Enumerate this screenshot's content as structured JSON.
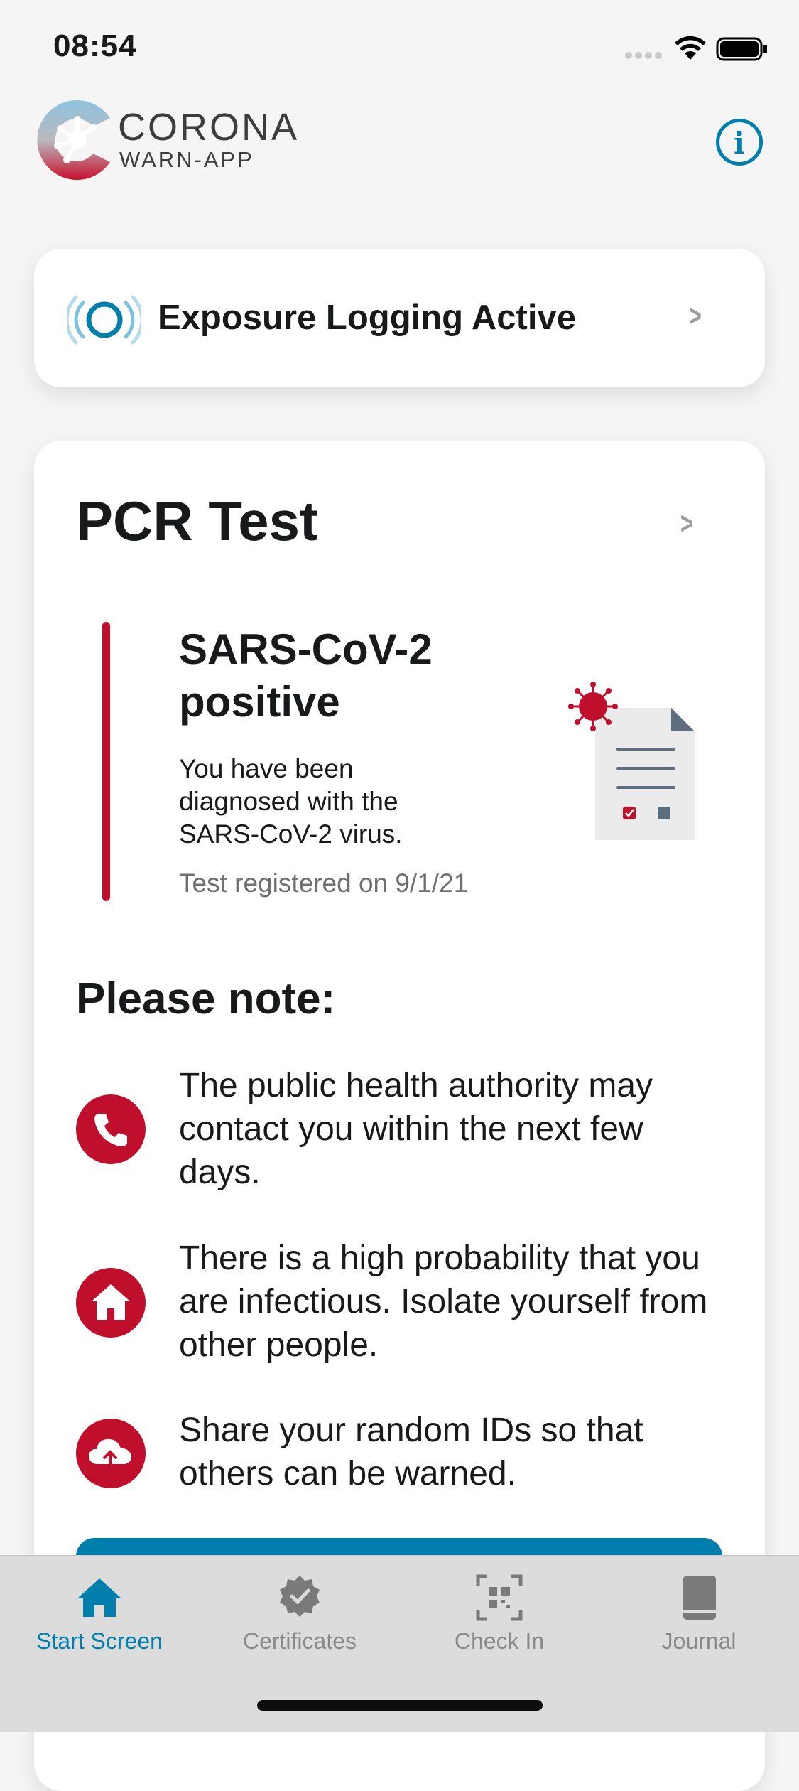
{
  "status_bar": {
    "time": "08:54"
  },
  "header": {
    "logo_title": "CORONA",
    "logo_subtitle": "WARN-APP",
    "info_glyph": "i"
  },
  "exposure_card": {
    "label": "Exposure Logging Active",
    "icon": "exposure-logging-icon"
  },
  "test_card": {
    "title": "PCR Test",
    "result_title": "SARS-CoV-2 positive",
    "result_description": "You have been diagnosed with the SARS-CoV-2 virus.",
    "registered": "Test registered on 9/1/21",
    "note_title": "Please note:",
    "notes": [
      {
        "icon": "phone-icon",
        "text": "The public health authority may contact you within the next few days."
      },
      {
        "icon": "home-icon",
        "text": "There is a high probability that you are infectious. Isolate yourself from other people."
      },
      {
        "icon": "cloud-upload-icon",
        "text": "Share your random IDs so that others can be warned."
      }
    ]
  },
  "tabs": [
    {
      "label": "Start Screen",
      "icon": "home-icon",
      "active": true
    },
    {
      "label": "Certificates",
      "icon": "certificate-icon",
      "active": false
    },
    {
      "label": "Check In",
      "icon": "qr-code-icon",
      "active": false
    },
    {
      "label": "Journal",
      "icon": "book-icon",
      "active": false
    }
  ],
  "colors": {
    "accent_blue": "#007fad",
    "alert_red": "#c00f2d",
    "text_dark": "#17191a",
    "text_gray": "#6f6f6f",
    "background": "#f5f5f5"
  }
}
